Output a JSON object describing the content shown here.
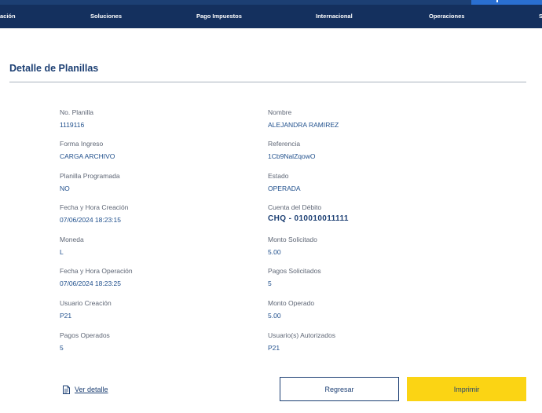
{
  "nav": {
    "items": [
      {
        "label": "ación"
      },
      {
        "label": "Soluciones"
      },
      {
        "label": "Pago Impuestos"
      },
      {
        "label": "Internacional"
      },
      {
        "label": "Operaciones"
      },
      {
        "label": "S"
      }
    ]
  },
  "page": {
    "title": "Detalle de Planillas"
  },
  "fields": {
    "left": [
      {
        "label": "No. Planilla",
        "value": "1119116"
      },
      {
        "label": "Forma Ingreso",
        "value": "CARGA ARCHIVO"
      },
      {
        "label": "Planilla Programada",
        "value": "NO"
      },
      {
        "label": "Fecha y Hora Creación",
        "value": "07/06/2024 18:23:15"
      },
      {
        "label": "Moneda",
        "value": "L"
      },
      {
        "label": "Fecha y Hora Operación",
        "value": "07/06/2024 18:23:25"
      },
      {
        "label": "Usuario Creación",
        "value": "P21"
      },
      {
        "label": "Pagos Operados",
        "value": "5"
      }
    ],
    "right": [
      {
        "label": "Nombre",
        "value": "ALEJANDRA RAMIREZ"
      },
      {
        "label": "Referencia",
        "value": "1Cb9NalZqowO"
      },
      {
        "label": "Estado",
        "value": "OPERADA"
      },
      {
        "label": "Cuenta del Débito",
        "value": "CHQ - 010010011111"
      },
      {
        "label": "Monto Solicitado",
        "value": "5.00"
      },
      {
        "label": "Pagos Solicitados",
        "value": "5"
      },
      {
        "label": "Monto Operado",
        "value": "5.00"
      },
      {
        "label": "Usuario(s) Autorizados",
        "value": "P21"
      }
    ]
  },
  "actions": {
    "detail_link": "Ver detalle",
    "back_label": "Regresar",
    "print_label": "Imprimir"
  },
  "icons": {
    "detail_link": "document-icon"
  },
  "colors": {
    "nav_background": "#14305e",
    "title": "#1c3f73",
    "value_text": "#1f4f8c",
    "print_button": "#fbd414"
  }
}
